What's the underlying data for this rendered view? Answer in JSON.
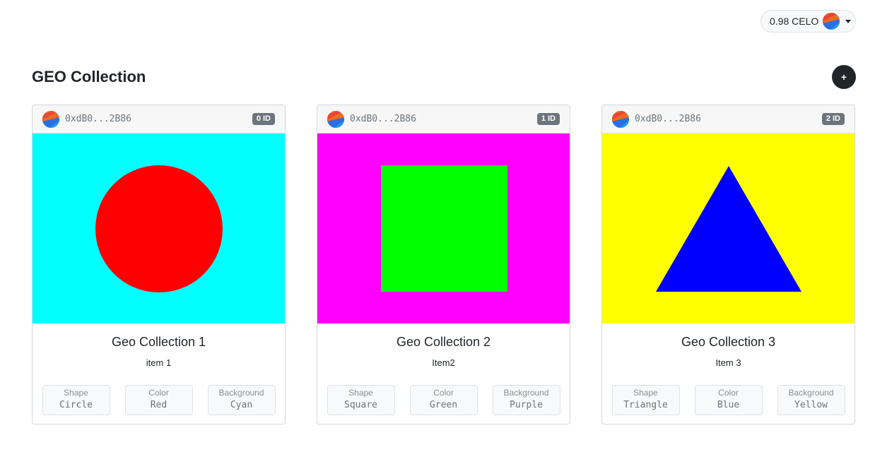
{
  "header": {
    "balance": "0.98 CELO"
  },
  "page": {
    "title": "GEO Collection",
    "add_button_label": "+"
  },
  "attr_labels": {
    "shape": "Shape",
    "color": "Color",
    "background": "Background"
  },
  "cards": [
    {
      "owner": "0xdB0...2B86",
      "badge": "0 ID",
      "title": "Geo Collection 1",
      "description": "item 1",
      "shape": "Circle",
      "color": "Red",
      "background": "Cyan",
      "shape_hex": "#ff0000",
      "background_hex": "#00ffff"
    },
    {
      "owner": "0xdB0...2B86",
      "badge": "1 ID",
      "title": "Geo Collection 2",
      "description": "Item2",
      "shape": "Square",
      "color": "Green",
      "background": "Purple",
      "shape_hex": "#00ff00",
      "background_hex": "#ff00ff"
    },
    {
      "owner": "0xdB0...2B86",
      "badge": "2 ID",
      "title": "Geo Collection 3",
      "description": "Item 3",
      "shape": "Triangle",
      "color": "Blue",
      "background": "Yellow",
      "shape_hex": "#0000ff",
      "background_hex": "#ffff00"
    }
  ],
  "icons": {
    "avatar": "blockie-avatar-icon",
    "caret": "caret-down-icon"
  }
}
